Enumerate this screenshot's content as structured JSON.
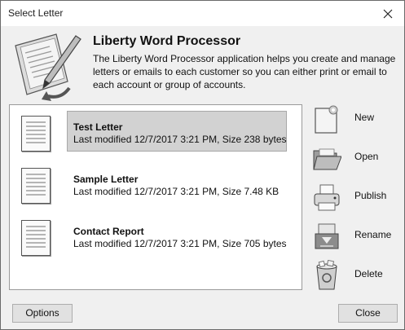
{
  "window": {
    "title": "Select Letter"
  },
  "header": {
    "app_title": "Liberty Word Processor",
    "description": "The Liberty Word Processor application helps you create and manage letters or emails to each customer so you can either print or email to each account or group of accounts."
  },
  "letters": [
    {
      "name": "Test Letter",
      "meta": "Last modified 12/7/2017 3:21 PM, Size  238 bytes",
      "selected": true
    },
    {
      "name": "Sample Letter",
      "meta": "Last modified 12/7/2017 3:21 PM, Size  7.48 KB",
      "selected": false
    },
    {
      "name": "Contact Report",
      "meta": "Last modified 12/7/2017 3:21 PM, Size  705 bytes",
      "selected": false
    }
  ],
  "actions": {
    "new": "New",
    "open": "Open",
    "publish": "Publish",
    "rename": "Rename",
    "delete": "Delete"
  },
  "buttons": {
    "options": "Options",
    "close": "Close"
  },
  "icons": {
    "close": "close-icon",
    "header": "pen-document-icon",
    "document": "document-icon",
    "new": "new-document-icon",
    "open": "folder-open-icon",
    "publish": "printer-icon",
    "rename": "rename-icon",
    "delete": "recycle-bin-icon"
  }
}
